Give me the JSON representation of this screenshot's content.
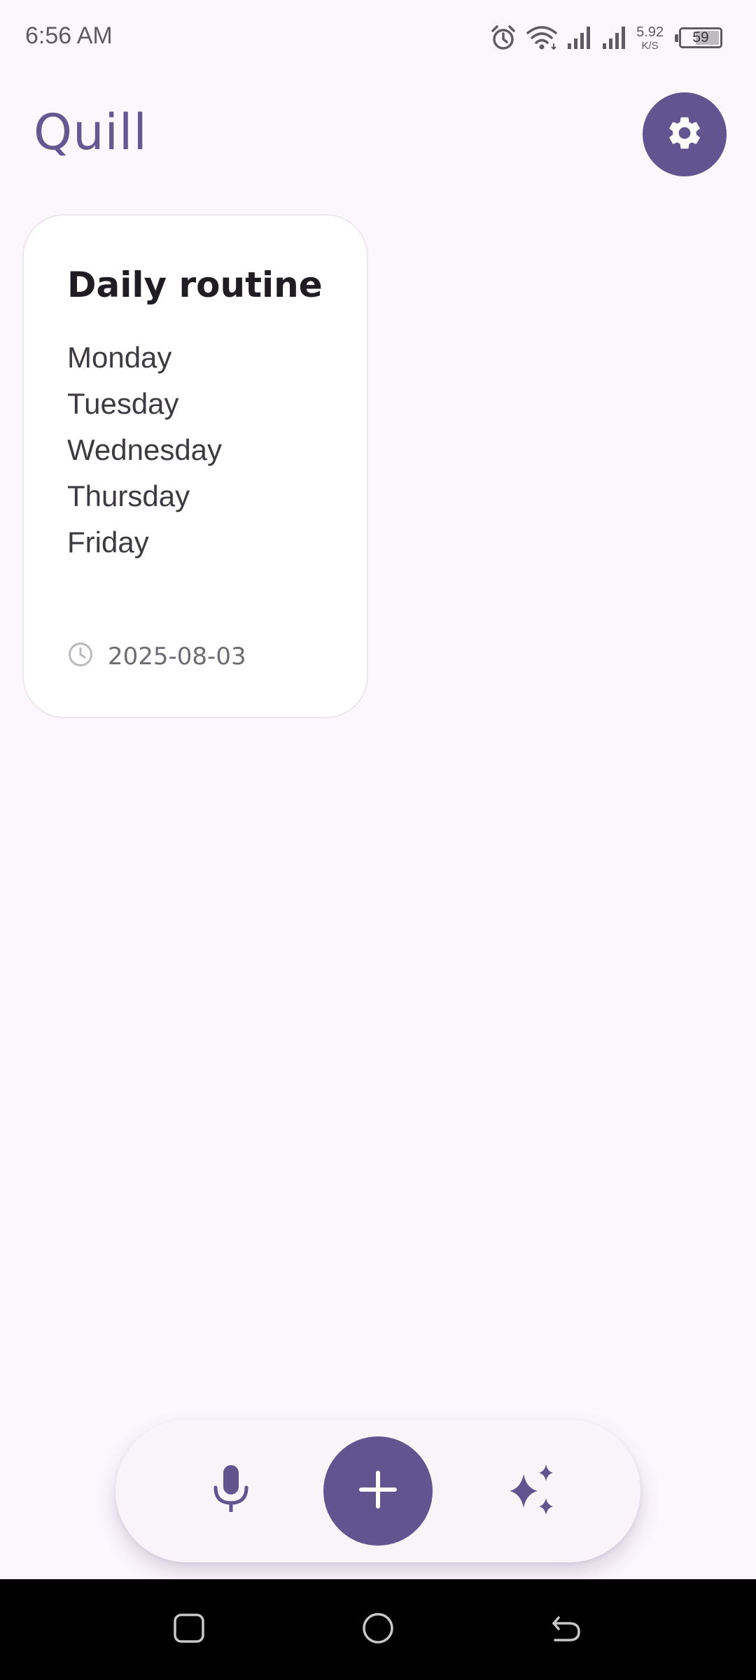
{
  "status_bar": {
    "time": "6:56 AM",
    "net_speed_value": "5.92",
    "net_speed_unit": "K/S",
    "battery_level": "59",
    "icons": [
      "alarm-icon",
      "wifi-icon",
      "signal-icon",
      "signal-icon"
    ]
  },
  "header": {
    "title": "Quill",
    "settings_icon": "gear-icon"
  },
  "notes": [
    {
      "title": "Daily routine",
      "lines": [
        "Monday",
        "Tuesday",
        "Wednesday",
        "Thursday",
        "Friday"
      ],
      "date": "2025-08-03",
      "date_icon": "clock-icon"
    }
  ],
  "action_bar": {
    "left_icon": "microphone-icon",
    "center_icon": "plus-icon",
    "right_icon": "sparkles-icon"
  },
  "system_nav": {
    "icons": [
      "recents-icon",
      "home-icon",
      "back-icon"
    ]
  },
  "colors": {
    "background": "#fcf7fd",
    "accent": "#62548e",
    "title": "#655891",
    "nav_bar": "#000000"
  }
}
